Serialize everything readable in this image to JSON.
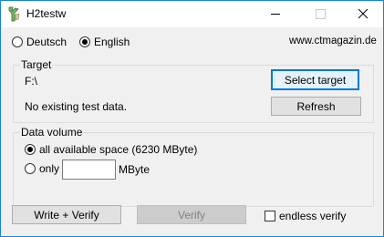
{
  "window": {
    "title": "H2testw",
    "icons": {
      "app": "h2testw-app-icon",
      "minimize": "minimize-icon",
      "maximize": "maximize-icon",
      "close": "close-icon"
    },
    "border_color": "#1883d7"
  },
  "language": {
    "options": [
      "Deutsch",
      "English"
    ],
    "selected": "English"
  },
  "website": "www.ctmagazin.de",
  "target": {
    "legend": "Target",
    "path": "F:\\",
    "status": "No existing test data.",
    "select_button": "Select target",
    "refresh_button": "Refresh"
  },
  "data_volume": {
    "legend": "Data volume",
    "all_label": "all available space (6230 MByte)",
    "only_label": "only",
    "amount_value": "",
    "unit_label": "MByte",
    "selected": "all"
  },
  "actions": {
    "write_verify": "Write + Verify",
    "verify": "Verify",
    "endless_verify": "endless verify",
    "endless_verify_checked": false
  },
  "colors": {
    "accent": "#0078d7",
    "button_face": "#e1e1e1",
    "disabled_face": "#cccccc",
    "disabled_text": "#838383"
  }
}
